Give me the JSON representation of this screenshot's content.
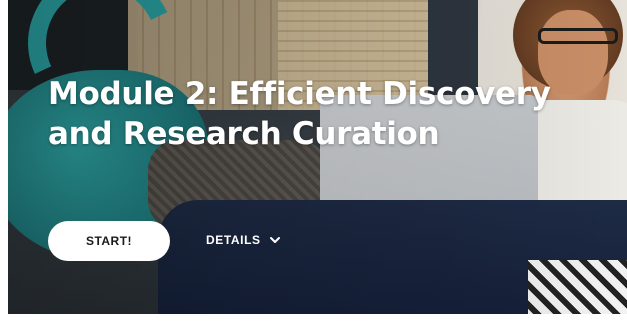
{
  "hero": {
    "title": "Module 2: Efficient Discovery and Research Curation",
    "start_label": "START!",
    "details_label": "DETAILS",
    "details_icon": "chevron-down-icon"
  },
  "colors": {
    "title_text": "#ffffff",
    "button_bg": "#ffffff",
    "button_text": "#1a1a1a"
  }
}
